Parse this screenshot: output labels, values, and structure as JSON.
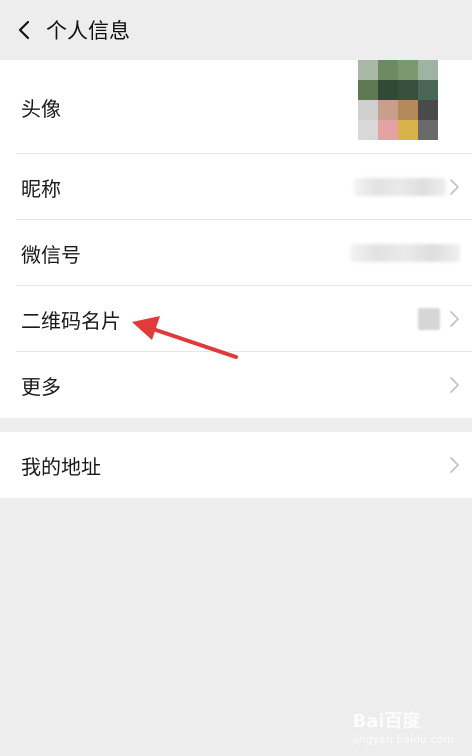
{
  "header": {
    "title": "个人信息"
  },
  "rows": {
    "avatar": {
      "label": "头像"
    },
    "nickname": {
      "label": "昵称",
      "value": ""
    },
    "wechat_id": {
      "label": "微信号",
      "value": ""
    },
    "qr_card": {
      "label": "二维码名片"
    },
    "more": {
      "label": "更多"
    },
    "address": {
      "label": "我的地址"
    }
  },
  "avatar_colors": [
    "#a9b8a6",
    "#6e8a62",
    "#7a9a6e",
    "#9fb3a5",
    "#5f7a52",
    "#2f4a35",
    "#3a4f3e",
    "#4a6656",
    "#cfcfcf",
    "#c79f8b",
    "#b58a5a",
    "#4a4a4a",
    "#d8d8d8",
    "#e4a3a0",
    "#d8b24a",
    "#6a6a6a"
  ],
  "colors": {
    "background": "#ededed",
    "accent_arrow": "#e03a3a"
  },
  "watermark": {
    "brand": "Bai百度",
    "sub": "jingyan.baidu.com"
  }
}
